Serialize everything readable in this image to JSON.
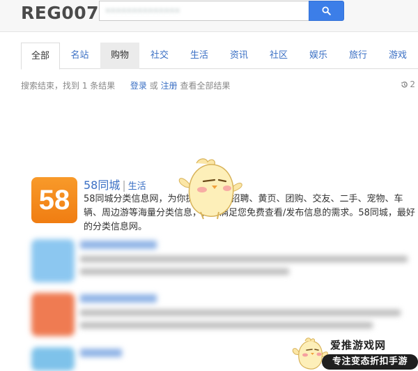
{
  "header": {
    "logo": "REG007",
    "search_value": "••••••••••••••"
  },
  "tabs": [
    {
      "label": "全部"
    },
    {
      "label": "名站"
    },
    {
      "label": "购物"
    },
    {
      "label": "社交"
    },
    {
      "label": "生活"
    },
    {
      "label": "资讯"
    },
    {
      "label": "社区"
    },
    {
      "label": "娱乐"
    },
    {
      "label": "旅行"
    },
    {
      "label": "游戏"
    }
  ],
  "summary": {
    "text": "搜索结束，找到 1 条结果",
    "login": "登录",
    "or": "或",
    "register": "注册",
    "view_all": "查看全部结果",
    "history_count": "2"
  },
  "result": {
    "icon_text": "58",
    "title": "58同城",
    "category": "生活",
    "description": "58同城分类信息网，为你提供房产、招聘、黄页、团购、交友、二手、宠物、车辆、周边游等海量分类信息，充分满足您免费查看/发布信息的需求。58同城，最好的分类信息网。"
  },
  "watermark": {
    "title": "爱推游戏网",
    "subtitle": "专注变态折扣手游"
  },
  "colors": {
    "accent": "#3c7ee8",
    "link": "#3a6fc4",
    "result_icon": "#f5891e"
  }
}
